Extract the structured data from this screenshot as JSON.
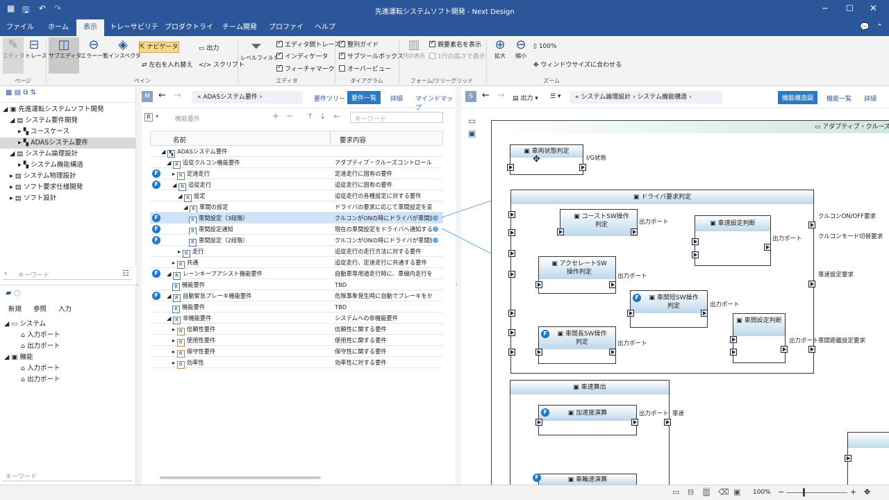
{
  "window": {
    "title": "先進運転システムソフト開発 - Next Design"
  },
  "menu_tabs": [
    "ファイル",
    "ホーム",
    "表示",
    "トレーサビリティ",
    "プロダクトライン",
    "チーム開発",
    "プロファイル",
    "ヘルプ"
  ],
  "ribbon": {
    "editor": "エディタ",
    "trace": "トレース",
    "subeditor": "サブエディタ",
    "errorlist": "エラー一覧",
    "inspector": "インスペクタ",
    "navigator": "ナビゲータ",
    "output": "出力",
    "swap": "左右を入れ替え",
    "script": "スクリプト",
    "levelfilter": "レベルフィルタ",
    "cb_editor_trace": "エディタ間トレース",
    "cb_indicator": "インディケータ",
    "cb_feature": "フィーチャマーク",
    "cb_align": "整列ガイド",
    "cb_subport": "サブツールボックス",
    "cb_overview": "オーバービュー",
    "colview": "列の表示",
    "cb_parentname": "親要素名を表示",
    "cb_rowheight": "1行の高さで表示",
    "zoomin": "拡大",
    "zoomout": "縮小",
    "zoom100": "100%",
    "fitwindow": "ウィンドウサイズに合わせる",
    "g_page": "ページ",
    "g_pane": "ペイン",
    "g_editor": "エディタ",
    "g_diagram": "ダイアグラム",
    "g_form": "フォーム/ツリーグリッド",
    "g_zoom": "ズーム"
  },
  "left_tree": [
    "先進運転システムソフト開発",
    "システム要件開発",
    "ユースケース",
    "ADASシステム要件",
    "システム論理設計",
    "システム機能構造",
    "システム物理設計",
    "ソフト要求仕様開発",
    "ソフト設計"
  ],
  "left_search_placeholder": "キーワード",
  "bottom_tabs": [
    "新規",
    "参照",
    "入力"
  ],
  "bottom_tree": [
    "システム",
    "入力ポート",
    "出力ポート",
    "機能",
    "入力ポート",
    "出力ポート"
  ],
  "bottom_search_placeholder": "キーワード",
  "mid": {
    "badge": "M",
    "breadcrumb": "« ADASシステム要件 ›",
    "views": [
      "要件ツリー",
      "要件一覧",
      "詳細",
      "マインドマップ"
    ],
    "filter_label": "機能要件",
    "search_placeholder": "キーワード",
    "col_name": "名前",
    "col_desc": "要求内容"
  },
  "rows": [
    {
      "n": "ADASシステム要件",
      "d": "",
      "lvl": 0,
      "f": false
    },
    {
      "n": "追従クルコン機能要件",
      "d": "アダプティブ・クルーズコントロールの機能要件",
      "lvl": 1,
      "f": false
    },
    {
      "n": "定速走行",
      "d": "定速走行に固有の要件",
      "lvl": 2,
      "f": true
    },
    {
      "n": "追従走行",
      "d": "追従走行に固有の要件",
      "lvl": 2,
      "f": true
    },
    {
      "n": "設定",
      "d": "追従走行の各種設定に対する要件",
      "lvl": 3,
      "f": false
    },
    {
      "n": "車間の設定",
      "d": "ドライバの要求に応じて車間設定を変更する",
      "lvl": 4,
      "f": false
    },
    {
      "n": "車間設定（3段階）",
      "d": "クルコンがONの時にドライバが車間設定を変更",
      "lvl": 5,
      "f": true
    },
    {
      "n": "車間設定通知",
      "d": "現在の車間設定をドライバへ通知する",
      "lvl": 5,
      "f": true
    },
    {
      "n": "車間設定（2段階）",
      "d": "クルコンがONの時にドライバが車間設定を変更",
      "lvl": 5,
      "f": true
    },
    {
      "n": "走行",
      "d": "追従走行の走行方法に対する要件",
      "lvl": 3,
      "f": false
    },
    {
      "n": "共通",
      "d": "追従走行、定速走行に共通する要件",
      "lvl": 2,
      "f": false
    },
    {
      "n": "レーンキープアシスト機能要件",
      "d": "自動車専用道走行時に、車線内走行を支援",
      "lvl": 1,
      "f": true
    },
    {
      "n": "機能要件",
      "d": "TBD",
      "lvl": 2,
      "f": false
    },
    {
      "n": "自動緊急ブレーキ機能要件",
      "d": "危険事象発生時に自動でブレーキをかける",
      "lvl": 1,
      "f": true
    },
    {
      "n": "機能要件",
      "d": "TBD",
      "lvl": 2,
      "f": false
    },
    {
      "n": "非機能要件",
      "d": "システムへの非機能要件",
      "lvl": 1,
      "f": false
    },
    {
      "n": "信頼性要件",
      "d": "信頼性に関する要件",
      "lvl": 2,
      "f": false
    },
    {
      "n": "使用性要件",
      "d": "使用性に関する要件",
      "lvl": 2,
      "f": false
    },
    {
      "n": "保守性要件",
      "d": "保守性に関する要件",
      "lvl": 2,
      "f": false
    },
    {
      "n": "効率性",
      "d": "効率性に対する要件",
      "lvl": 2,
      "f": false
    }
  ],
  "right": {
    "badge": "S",
    "output": "出力",
    "breadcrumb": "« システム論理設計 › システム機能構造 ›",
    "views": [
      "機能構造図",
      "機能一覧",
      "詳細"
    ]
  },
  "diagram": {
    "outer": "アダプティブ・クルーズ",
    "b_state": "車両状態判定",
    "ig": "I/G状態",
    "b_driver": "ドライバ要求判定",
    "b_coast": "コーストSW操作判定",
    "b_set": "車速設定判断",
    "b_accel": "アクセレートSW操作判定",
    "b_short": "車間短SW操作判定",
    "b_dist": "車間設定判断",
    "b_long": "車間長SW操作判定",
    "out": "出力ポート",
    "o_cc": "クルコンON/OFF要求",
    "o_mode": "クルコンモード切替要求",
    "o_speed": "車速設定要求",
    "o_dist": "車間距離設定要求",
    "b_vcalc": "車速算出",
    "b_acc": "加速度演算",
    "speed": "車速",
    "b_wheel": "車輪速演算"
  },
  "status": {
    "zoom": "100%"
  }
}
